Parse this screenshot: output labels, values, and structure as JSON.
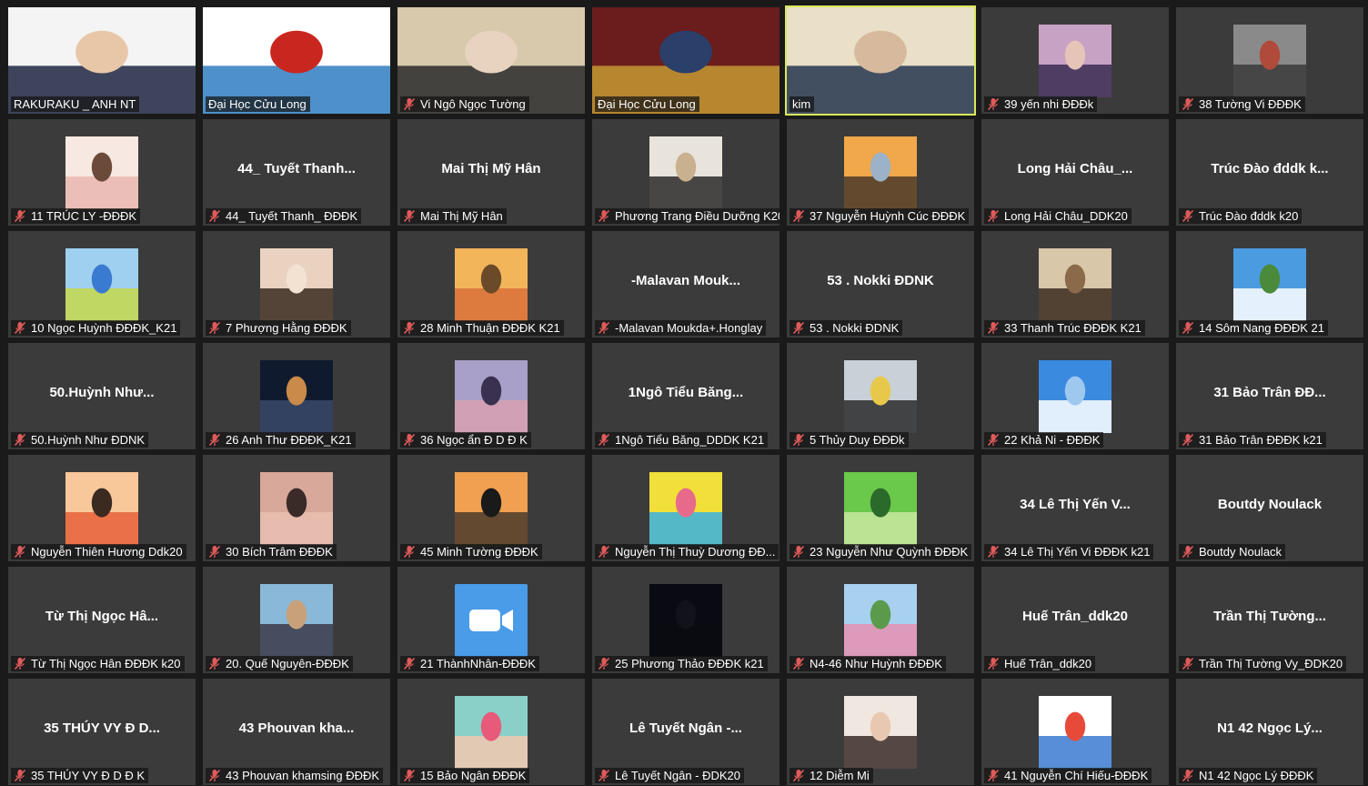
{
  "tiles": [
    {
      "label": "RAKURAKU _ ANH NT",
      "muted": false,
      "kind": "video",
      "palette": [
        "#f4f4f4",
        "#1d2540",
        "#e8c7a8"
      ]
    },
    {
      "label": "Đại Học Cửu Long",
      "muted": false,
      "kind": "video",
      "palette": [
        "#ffffff",
        "#2f7dbf",
        "#c9261f"
      ]
    },
    {
      "label": "Vi Ngô Ngọc Tường",
      "muted": true,
      "kind": "video",
      "palette": [
        "#d8c9ad",
        "#2a2a2a",
        "#e8d2c0"
      ]
    },
    {
      "label": "Đại Học Cửu Long",
      "muted": false,
      "kind": "video",
      "palette": [
        "#6b1d1d",
        "#c49a34",
        "#2a3f6a"
      ]
    },
    {
      "label": "kim",
      "muted": false,
      "kind": "video",
      "active": true,
      "palette": [
        "#e9e0c7",
        "#25354f",
        "#d7b99d"
      ]
    },
    {
      "label": "39 yến nhi ĐĐĐk",
      "muted": true,
      "kind": "avatar",
      "palette": [
        "#c7a2c4",
        "#3a2c54",
        "#e6c4b8"
      ]
    },
    {
      "label": "38 Tường Vi ĐĐĐK",
      "muted": true,
      "kind": "avatar",
      "palette": [
        "#8a8a8a",
        "#3a3a3a",
        "#b04a3a"
      ]
    },
    {
      "label": "11 TRÚC LY -ĐĐĐK",
      "muted": true,
      "kind": "avatar",
      "palette": [
        "#f7e8e1",
        "#e9b7b0",
        "#6b4a3a"
      ]
    },
    {
      "label": "44_ Tuyết Thanh_ ĐĐĐK",
      "muted": true,
      "kind": "name",
      "center": "44_ Tuyết Thanh..."
    },
    {
      "label": "Mai Thị Mỹ Hân",
      "muted": true,
      "kind": "name",
      "center": "Mai Thị Mỹ Hân"
    },
    {
      "label": "Phương Trang Điều Dưỡng K20",
      "muted": true,
      "kind": "avatar",
      "palette": [
        "#e8e4dc",
        "#2a2a2a",
        "#c9b08e"
      ]
    },
    {
      "label": "37 Nguyễn Huỳnh Cúc ĐĐĐK",
      "muted": true,
      "kind": "avatar",
      "palette": [
        "#f0a84a",
        "#4a3a2a",
        "#9bb2c8"
      ]
    },
    {
      "label": "Long Hải Châu_DDK20",
      "muted": true,
      "kind": "name",
      "center": "Long Hải Châu_..."
    },
    {
      "label": "Trúc Đào đddk k20",
      "muted": true,
      "kind": "name",
      "center": "Trúc Đào đddk k..."
    },
    {
      "label": "10 Ngọc Huỳnh ĐĐĐK_K21",
      "muted": true,
      "kind": "avatar",
      "palette": [
        "#9fd0ef",
        "#c6d84a",
        "#3a7ad0"
      ]
    },
    {
      "label": "7 Phượng Hằng ĐĐĐK",
      "muted": true,
      "kind": "avatar",
      "palette": [
        "#e9d3c0",
        "#3a2a20",
        "#f3e2d2"
      ]
    },
    {
      "label": "28 Minh Thuận ĐĐĐK K21",
      "muted": true,
      "kind": "avatar",
      "palette": [
        "#f2b55a",
        "#d9703a",
        "#6b4a2a"
      ]
    },
    {
      "label": "-Malavan Moukda+.Honglay",
      "muted": true,
      "kind": "name",
      "center": "-Malavan Mouk..."
    },
    {
      "label": "53 . Nokki ĐDNK",
      "muted": true,
      "kind": "name",
      "center": "53 . Nokki ĐDNK"
    },
    {
      "label": "33 Thanh Trúc ĐĐĐK K21",
      "muted": true,
      "kind": "avatar",
      "palette": [
        "#d9c7a9",
        "#3a2a20",
        "#8a6a4a"
      ]
    },
    {
      "label": "14 Sôm Nang ĐĐĐK 21",
      "muted": true,
      "kind": "avatar",
      "palette": [
        "#4a9be0",
        "#ffffff",
        "#4a8a3a"
      ]
    },
    {
      "label": "50.Huỳnh Như ĐDNK",
      "muted": true,
      "kind": "name",
      "center": "50.Huỳnh Như..."
    },
    {
      "label": "26 Anh Thư ĐĐĐK_K21",
      "muted": true,
      "kind": "avatar",
      "palette": [
        "#0f1a2e",
        "#3a4a6a",
        "#c98a4a"
      ]
    },
    {
      "label": "36 Ngọc ẩn Đ D Đ K",
      "muted": true,
      "kind": "avatar",
      "palette": [
        "#a8a0c8",
        "#d8a0b0",
        "#3a3050"
      ]
    },
    {
      "label": "1Ngô Tiểu Băng_DDDK K21",
      "muted": true,
      "kind": "name",
      "center": "1Ngô Tiểu Băng..."
    },
    {
      "label": "5 Thủy Duy ĐĐĐk",
      "muted": true,
      "kind": "avatar",
      "palette": [
        "#c8d0d8",
        "#2a2a2a",
        "#e8c84a"
      ]
    },
    {
      "label": "22 Khả Ni - ĐĐĐK",
      "muted": true,
      "kind": "avatar",
      "palette": [
        "#3a8ae0",
        "#ffffff",
        "#9fc8ef"
      ]
    },
    {
      "label": "31 Bảo Trân ĐĐĐK k21",
      "muted": true,
      "kind": "name",
      "center": "31 Bảo Trân ĐĐ..."
    },
    {
      "label": "Nguyễn Thiên Hương Ddk20",
      "muted": true,
      "kind": "avatar",
      "palette": [
        "#f8c89a",
        "#e8603a",
        "#3a2a20"
      ]
    },
    {
      "label": "30 Bích Trâm ĐĐĐK",
      "muted": true,
      "kind": "avatar",
      "palette": [
        "#d8a89a",
        "#e8c0b0",
        "#3a2a28"
      ]
    },
    {
      "label": "45 Minh Tường ĐĐĐK",
      "muted": true,
      "kind": "avatar",
      "palette": [
        "#f0a050",
        "#4a3a2a",
        "#1a1a1a"
      ]
    },
    {
      "label": "Nguyễn Thị Thuỳ Dương ĐĐ...",
      "muted": true,
      "kind": "avatar",
      "palette": [
        "#f2e03a",
        "#3ab0e0",
        "#e86a8a"
      ]
    },
    {
      "label": "23 Nguyễn Như Quỳnh ĐĐĐK",
      "muted": true,
      "kind": "avatar",
      "palette": [
        "#6ac84a",
        "#c8e8a0",
        "#2a6a2a"
      ]
    },
    {
      "label": "34 Lê Thị Yến Vi ĐĐĐK k21",
      "muted": true,
      "kind": "name",
      "center": "34 Lê Thị Yến V..."
    },
    {
      "label": "Boutdy Noulack",
      "muted": true,
      "kind": "name",
      "center": "Boutdy Noulack"
    },
    {
      "label": "Từ Thị Ngọc Hân ĐĐĐK k20",
      "muted": true,
      "kind": "name",
      "center": "Từ Thị Ngọc Hâ..."
    },
    {
      "label": "20. Quế Nguyên-ĐĐĐK",
      "muted": true,
      "kind": "avatar",
      "palette": [
        "#8ab8d8",
        "#3a3a4a",
        "#c8a07a"
      ]
    },
    {
      "label": "21 ThànhNhân-ĐĐĐK",
      "muted": true,
      "kind": "zoom"
    },
    {
      "label": "25 Phương Thảo ĐĐĐK k21",
      "muted": true,
      "kind": "avatar",
      "palette": [
        "#0a0a12",
        "#0a0a12",
        "#12121a"
      ]
    },
    {
      "label": "N4-46 Như Huỳnh ĐĐĐK",
      "muted": true,
      "kind": "avatar",
      "palette": [
        "#a8d0ef",
        "#e890b0",
        "#5a9a4a"
      ]
    },
    {
      "label": "Huế Trân_ddk20",
      "muted": true,
      "kind": "name",
      "center": "Huế Trân_ddk20"
    },
    {
      "label": "Trần Thị Tường Vy_ĐDK20",
      "muted": true,
      "kind": "name",
      "center": "Trần Thị Tường..."
    },
    {
      "label": "35 THÚY VY Đ D Đ K",
      "muted": true,
      "kind": "name",
      "center": "35 THÚY VY Đ D..."
    },
    {
      "label": "43 Phouvan khamsing ĐĐĐK",
      "muted": true,
      "kind": "name",
      "center": "43 Phouvan kha..."
    },
    {
      "label": "15 Bảo Ngân ĐĐĐK",
      "muted": true,
      "kind": "avatar",
      "palette": [
        "#8ad0c8",
        "#f0c8b0",
        "#e85a7a"
      ]
    },
    {
      "label": "Lê Tuyết Ngân - ĐDK20",
      "muted": true,
      "kind": "name",
      "center": "Lê Tuyết Ngân -..."
    },
    {
      "label": "12 Diễm Mi",
      "muted": true,
      "kind": "avatar",
      "palette": [
        "#f0e8e0",
        "#3a2a28",
        "#e8c8b0"
      ]
    },
    {
      "label": "41 Nguyễn Chí Hiếu-ĐĐĐK",
      "muted": true,
      "kind": "avatar",
      "palette": [
        "#ffffff",
        "#3a7ad0",
        "#e84a3a"
      ]
    },
    {
      "label": "N1 42 Ngọc Lý ĐĐĐK",
      "muted": true,
      "kind": "name",
      "center": "N1 42 Ngọc Lý..."
    }
  ]
}
